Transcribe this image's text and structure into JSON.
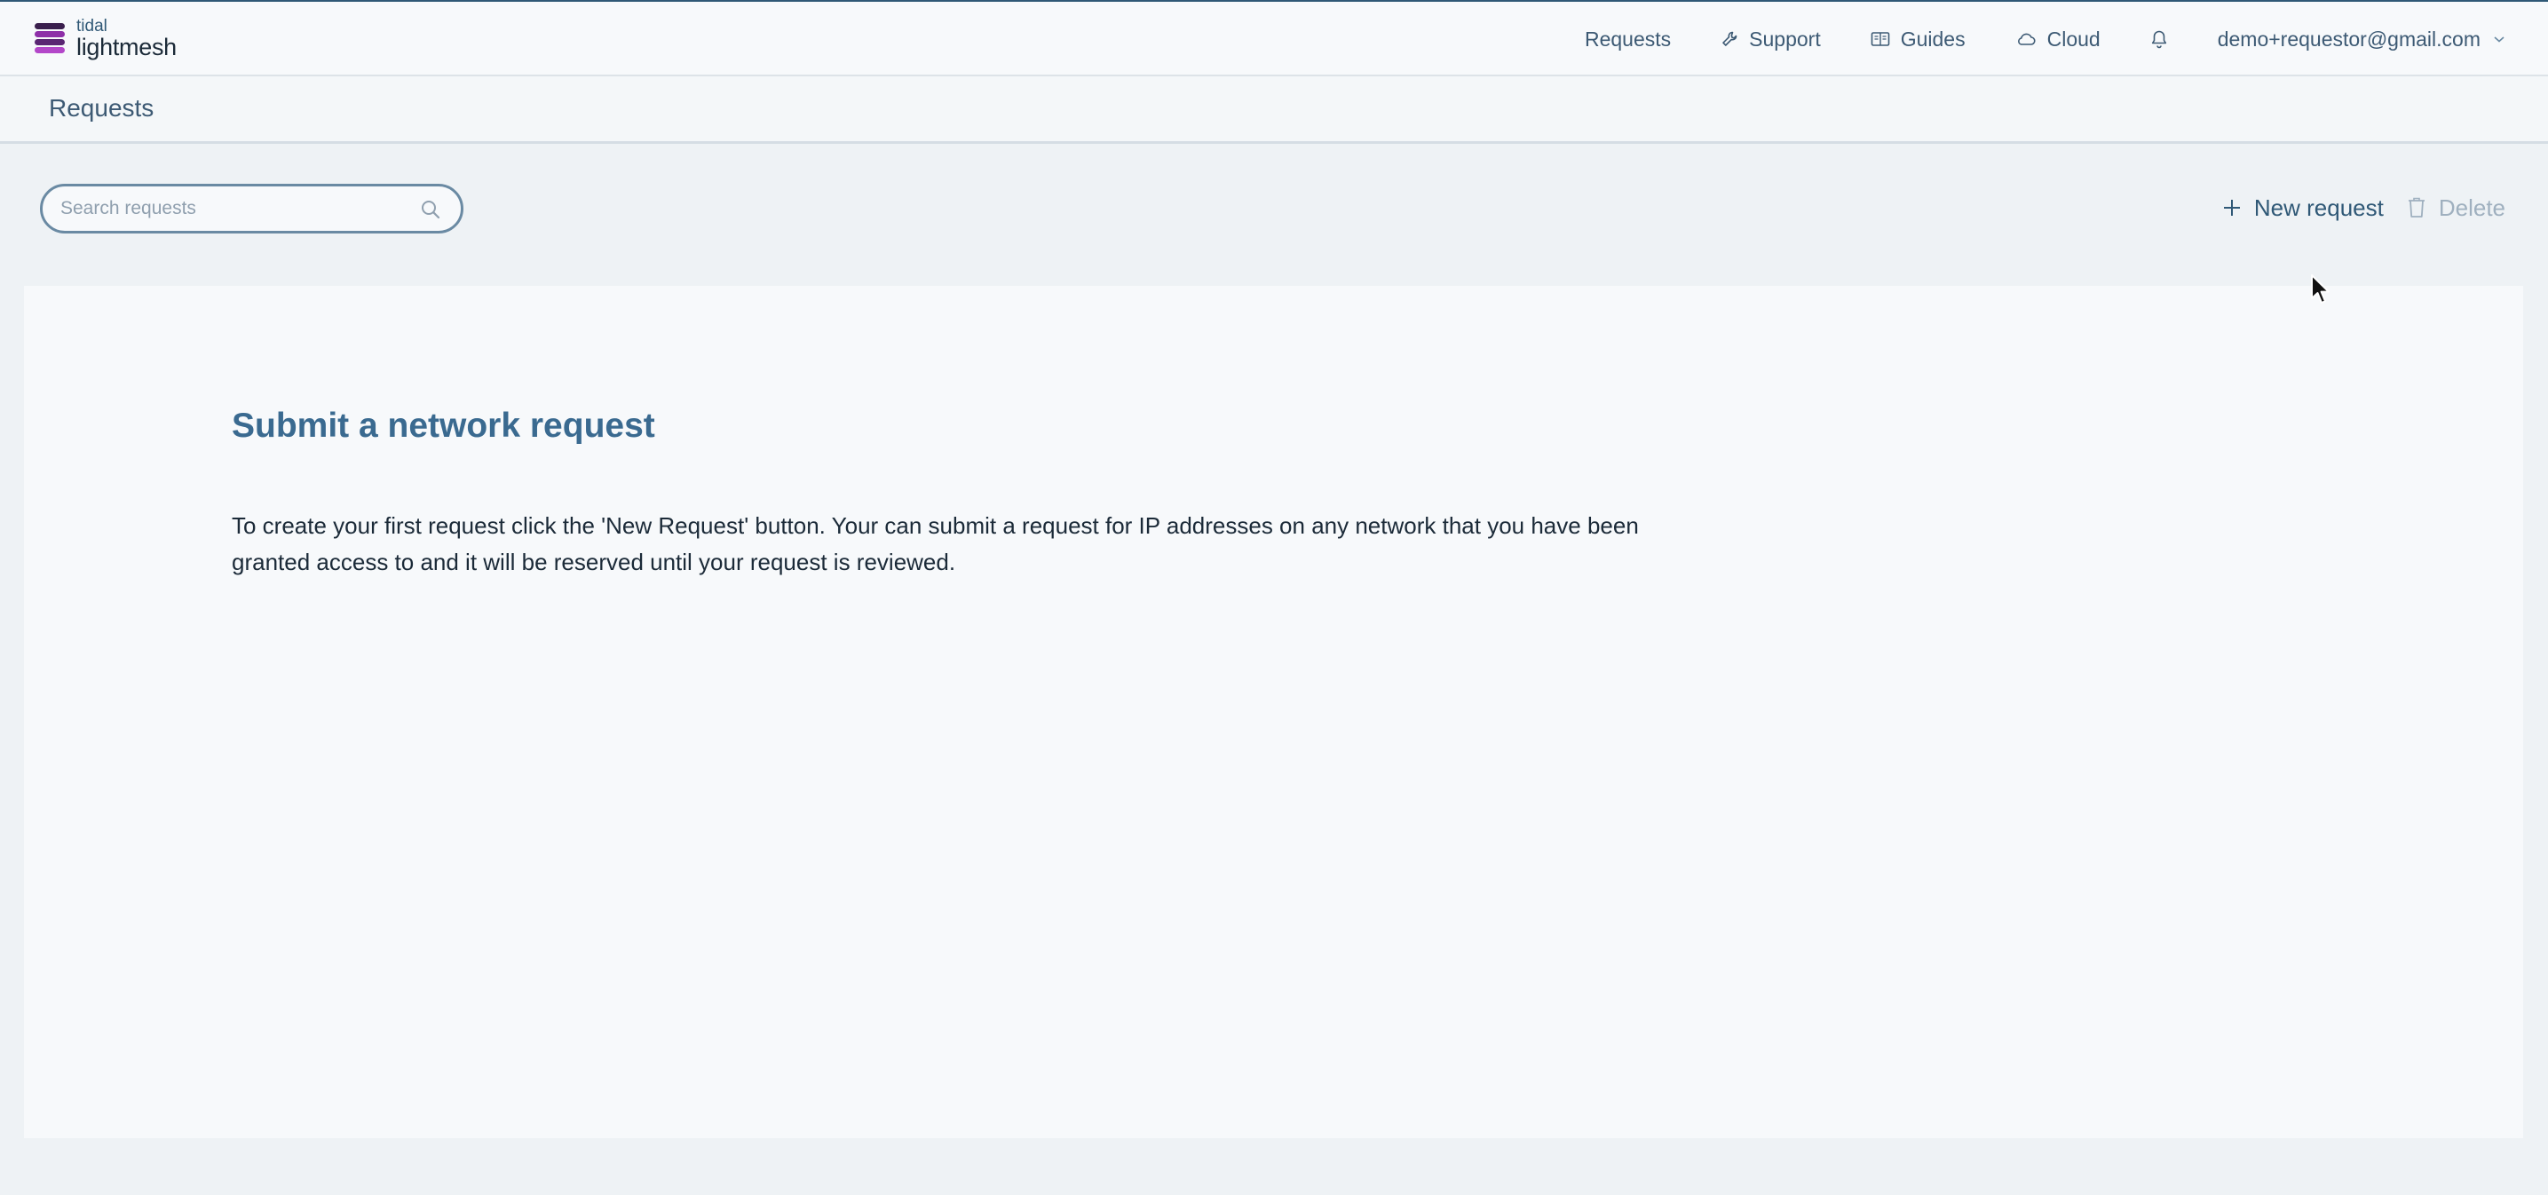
{
  "app": {
    "logo_small": "tidal",
    "logo_big": "lightmesh",
    "logo_icon": "layered-stack-logo"
  },
  "nav": {
    "requests": "Requests",
    "support": "Support",
    "guides": "Guides",
    "cloud": "Cloud",
    "notifications_icon": "bell-icon",
    "user": "demo+requestor@gmail.com"
  },
  "page": {
    "title": "Requests"
  },
  "search": {
    "placeholder": "Search requests",
    "value": ""
  },
  "toolbar": {
    "new_label": "New request",
    "delete_label": "Delete"
  },
  "empty_state": {
    "title": "Submit a network request",
    "description": "To create your first request click the 'New Request' button. Your can submit a request for IP addresses on any network that you have been granted access to and it will be reserved until your request is reviewed."
  },
  "colors": {
    "accent": "#2f5876",
    "title": "#3a6a90",
    "disabled": "#9fb0bf",
    "logo_purple": "#8e2fa8"
  }
}
